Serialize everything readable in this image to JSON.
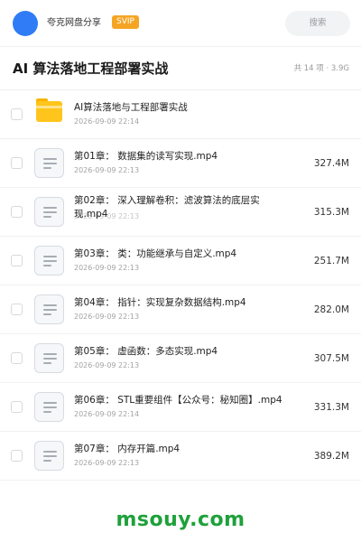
{
  "header": {
    "user_name": "夸克网盘分享",
    "badge": "SVIP",
    "search_placeholder": "搜索"
  },
  "folder": {
    "title": "AI 算法落地工程部署实战",
    "meta": "共 14 项 · 3.9G"
  },
  "items": [
    {
      "type": "folder",
      "name": "AI算法落地与工程部署实战",
      "date": "2026-09-09 22:14",
      "size": ""
    },
    {
      "type": "file",
      "name": "第01章： 数据集的读写实现.mp4",
      "date": "2026-09-09 22:13",
      "size": "327.4M"
    },
    {
      "type": "file",
      "name": "第02章： 深入理解卷积：滤波算法的底层实现.mp4",
      "date": "2026-09-09 22:13",
      "size": "315.3M"
    },
    {
      "type": "file",
      "name": "第03章： 类：功能继承与自定义.mp4",
      "date": "2026-09-09 22:13",
      "size": "251.7M"
    },
    {
      "type": "file",
      "name": "第04章： 指针：实现复杂数据结构.mp4",
      "date": "2026-09-09 22:13",
      "size": "282.0M"
    },
    {
      "type": "file",
      "name": "第05章： 虚函数：多态实现.mp4",
      "date": "2026-09-09 22:13",
      "size": "307.5M"
    },
    {
      "type": "file",
      "name": "第06章： STL重要组件【公众号：秘知圈】.mp4",
      "date": "2026-09-09 22:14",
      "size": "331.3M"
    },
    {
      "type": "file",
      "name": "第07章： 内存开篇.mp4",
      "date": "2026-09-09 22:13",
      "size": "389.2M"
    }
  ],
  "footer": {
    "watermark": "msouy.com"
  },
  "colors": {
    "avatar": "#2f7cf6",
    "svip_badge": "#f5a524",
    "folder": "#ffc51c",
    "watermark": "#1ea13a"
  }
}
